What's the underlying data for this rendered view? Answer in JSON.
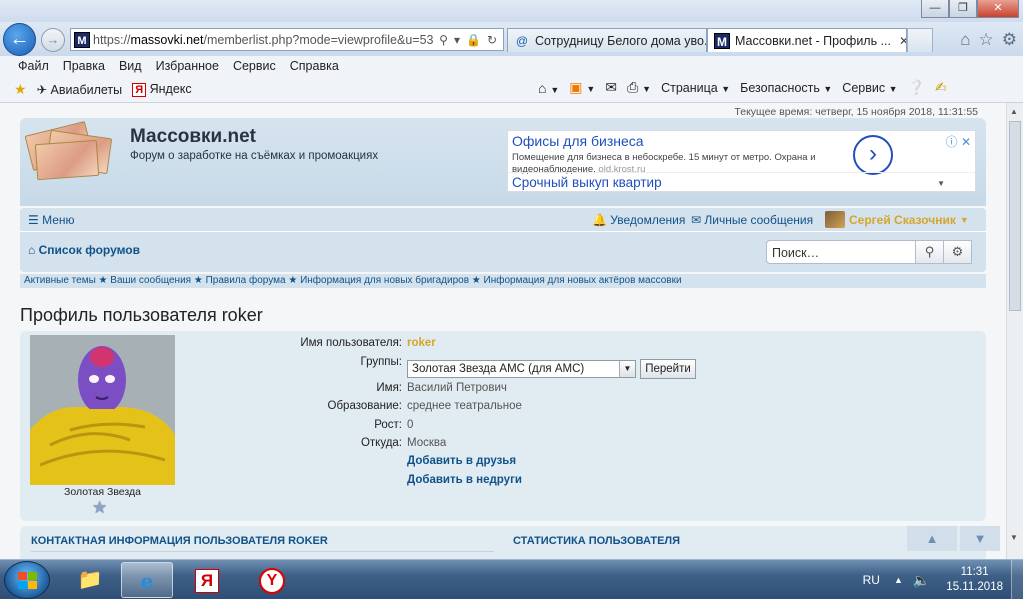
{
  "browser": {
    "window_buttons": {
      "minimize": "—",
      "restore": "❐",
      "close": "✕"
    },
    "address": {
      "url_prefix": "https://",
      "url_host": "massovki.net",
      "url_path": "/memberlist.php?mode=viewprofile&u=53"
    },
    "tabs": [
      {
        "label": "Сотрудницу Белого дома уво...",
        "icon": "at-sign-icon"
      },
      {
        "label": "Массовки.net - Профиль ...",
        "icon": "m-favicon",
        "active": true,
        "close": "✕"
      }
    ],
    "menu": [
      "Файл",
      "Правка",
      "Вид",
      "Избранное",
      "Сервис",
      "Справка"
    ],
    "favorites": [
      {
        "label": "Авиабилеты",
        "icon": "airplane-icon"
      },
      {
        "label": "Яндекс",
        "icon": "yandex-icon"
      }
    ],
    "commands": {
      "page": "Страница",
      "safety": "Безопасность",
      "service": "Сервис"
    }
  },
  "site": {
    "current_time": "Текущее время: четверг, 15 ноября 2018, 11:31:55",
    "title": "Массовки.net",
    "subtitle": "Форум о заработке на съёмках и промоакциях",
    "ad": {
      "title": "Офисы для бизнеса",
      "desc": "Помещение для бизнеса в небоскребе. 15 минут от метро. Охрана и видеонаблюдение.",
      "domain": "old.krost.ru",
      "second": "Срочный выкуп квартир"
    },
    "nav": {
      "menu": "Меню",
      "notifications": "Уведомления",
      "messages": "Личные сообщения",
      "username": "Сергей Сказочник",
      "forum_list": "Список форумов",
      "search_placeholder": "Поиск…"
    },
    "quicklinks": "Активные темы ★ Ваши сообщения ★ Правила форума ★ Информация для новых бригадиров ★ Информация для новых актёров массовки"
  },
  "profile": {
    "heading": "Профиль пользователя roker",
    "rank": "Золотая Звезда",
    "fields": {
      "username_label": "Имя пользователя:",
      "username": "roker",
      "groups_label": "Группы:",
      "group_selected": "Золотая Звезда АМС (для АМС)",
      "go_button": "Перейти",
      "name_label": "Имя:",
      "name": "Василий Петрович",
      "education_label": "Образование:",
      "education": "среднее театральное",
      "height_label": "Рост:",
      "height": "0",
      "from_label": "Откуда:",
      "from": "Москва",
      "add_friend": "Добавить в друзья",
      "add_foe": "Добавить в недруги"
    },
    "contact_heading": "КОНТАКТНАЯ ИНФОРМАЦИЯ ПОЛЬЗОВАТЕЛЯ ROKER",
    "stats_heading": "СТАТИСТИКА ПОЛЬЗОВАТЕЛЯ"
  },
  "taskbar": {
    "lang": "RU",
    "time": "11:31",
    "date": "15.11.2018"
  }
}
